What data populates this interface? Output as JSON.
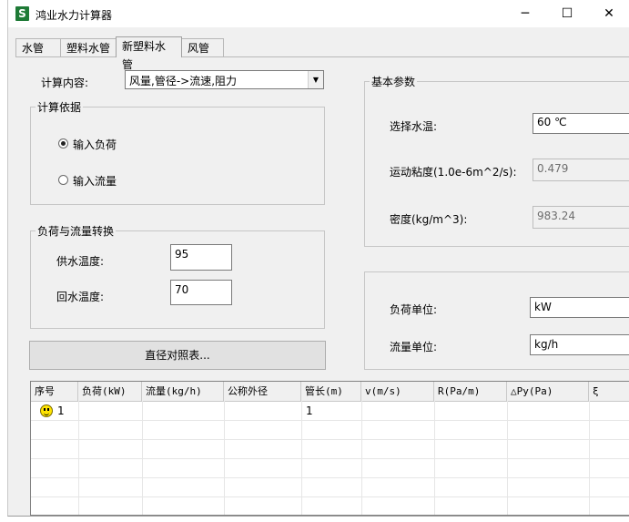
{
  "window": {
    "title": "鸿业水力计算器",
    "app_icon_glyph": "S",
    "minimize_glyph": "─",
    "maximize_glyph": "☐",
    "close_glyph": "✕"
  },
  "tabs": [
    {
      "label": "水管",
      "active": false
    },
    {
      "label": "塑料水管",
      "active": false
    },
    {
      "label": "新塑料水管",
      "active": true
    },
    {
      "label": "风管",
      "active": false
    }
  ],
  "calc_content": {
    "label": "计算内容:",
    "value": "风量,管径->流速,阻力",
    "dropdown_glyph": "▼"
  },
  "calc_basis": {
    "title": "计算依据",
    "options": [
      {
        "label": "输入负荷",
        "checked": true
      },
      {
        "label": "输入流量",
        "checked": false
      }
    ]
  },
  "conversion": {
    "title": "负荷与流量转换",
    "supply_temp_label": "供水温度:",
    "supply_temp_value": "95",
    "return_temp_label": "回水温度:",
    "return_temp_value": "70"
  },
  "diameter_button": "直径对照表...",
  "basic_params": {
    "title": "基本参数",
    "water_temp_label": "选择水温:",
    "water_temp_value": "60  ℃",
    "viscosity_label": "运动粘度(1.0e-6m^2/s):",
    "viscosity_value": "0.479",
    "density_label": "密度(kg/m^3):",
    "density_value": "983.24"
  },
  "units": {
    "load_unit_label": "负荷单位:",
    "load_unit_value": "kW",
    "flow_unit_label": "流量单位:",
    "flow_unit_value": "kg/h"
  },
  "table": {
    "columns": [
      "序号",
      "负荷(kW)",
      "流量(kg/h)",
      "公称外径",
      "管长(m)",
      "v(m/s)",
      "R(Pa/m)",
      "△Py(Pa)",
      "ξ"
    ],
    "rows": [
      {
        "index": "1",
        "length": "1",
        "icon": "smiley-icon"
      }
    ]
  }
}
